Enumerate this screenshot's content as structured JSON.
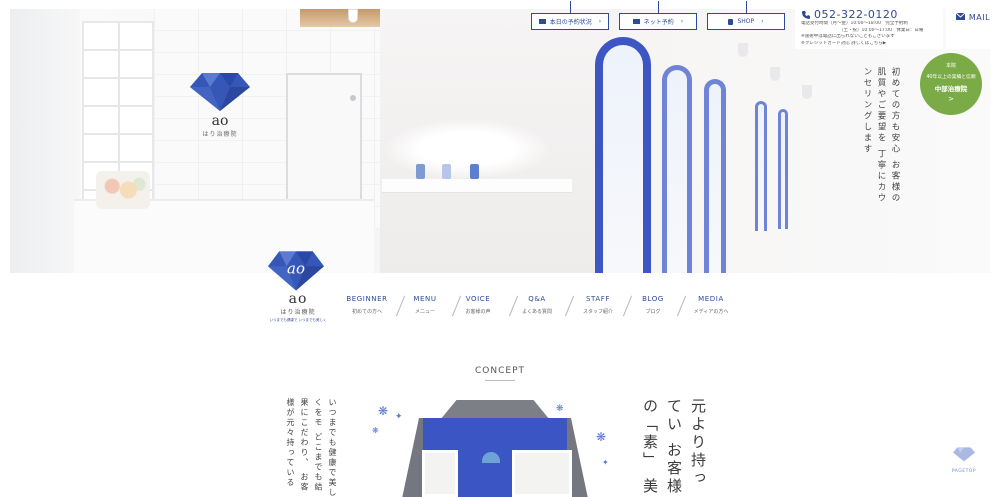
{
  "header": {
    "buttons": [
      {
        "label": "本日の予約状況",
        "icon": "calendar-icon"
      },
      {
        "label": "ネット予約",
        "icon": "laptop-icon"
      },
      {
        "label": "SHOP",
        "icon": "lock-icon"
      }
    ],
    "contact": {
      "phone": "052-322-0120",
      "hours_line1": "電話受付時間（月～金）10:00～18:00　完全予約制",
      "hours_line2": "（土・祝）10:00～17:00　休業日：日曜",
      "note1": "※施術中は電話に出られないこともございます",
      "note2": "※クレジットカード対応 詳しくはこちら▶"
    },
    "mail_label": "MAIL",
    "branch_badge": {
      "label_top": "本院",
      "label_sub": "40年以上の実績と信頼",
      "name": "中部治療院",
      "arrow": ">"
    }
  },
  "hero": {
    "vertical_text": "初めての方も安心 お客様の肌質やご要望を 丁寧にカウンセリングします",
    "watermark": "ao"
  },
  "logo": {
    "mark": "ao",
    "name": "ao",
    "subname": "はり治療院",
    "tagline": "いつまでも健康で いつまでも美しく"
  },
  "nav": [
    {
      "en": "BEGINNER",
      "jp": "初めての方へ"
    },
    {
      "en": "MENU",
      "jp": "メニュー"
    },
    {
      "en": "VOICE",
      "jp": "お客様の声"
    },
    {
      "en": "Q&A",
      "jp": "よくある質問"
    },
    {
      "en": "STAFF",
      "jp": "スタッフ紹介"
    },
    {
      "en": "BLOG",
      "jp": "ブログ"
    },
    {
      "en": "MEDIA",
      "jp": "メディアの方へ"
    }
  ],
  "concept": {
    "heading": "CONCEPT",
    "body": "いつまでも健康で美しくをモ どこまでも結果にこだわり、 お客様が元々持っている「素 引き出すお手伝いをいたしま",
    "lead": "元より持ってい お客様の「素」 美しさを引き出"
  },
  "pagetop_label": "PAGETOP",
  "colors": {
    "brand_blue": "#2e4a98",
    "accent_blue": "#3d56c4",
    "green": "#7bab46"
  }
}
